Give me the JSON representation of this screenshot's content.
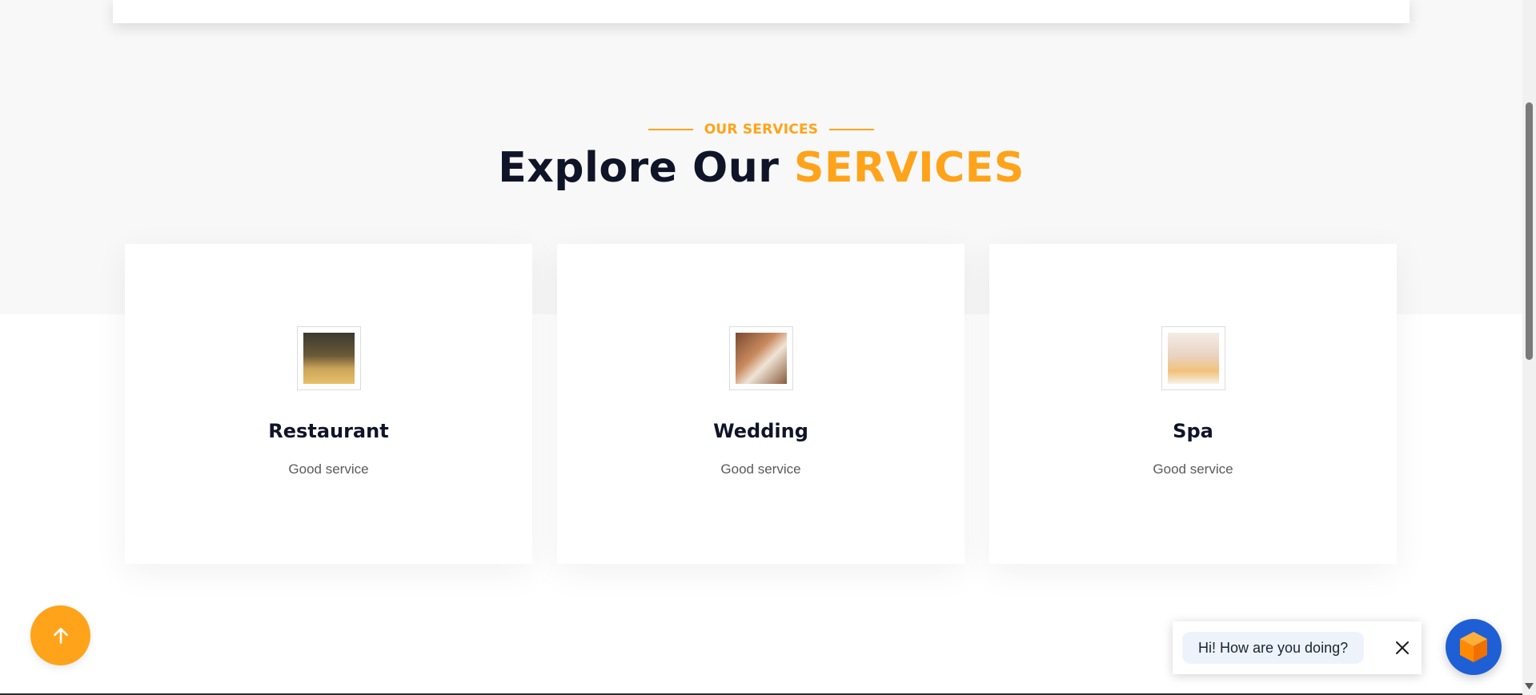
{
  "section": {
    "eyebrow": "OUR SERVICES",
    "heading_main": "Explore Our ",
    "heading_accent": "SERVICES"
  },
  "services": [
    {
      "title": "Restaurant",
      "description": "Good service",
      "image": "restaurant-photo"
    },
    {
      "title": "Wedding",
      "description": "Good service",
      "image": "wedding-photo"
    },
    {
      "title": "Spa",
      "description": "Good service",
      "image": "spa-photo"
    }
  ],
  "chat": {
    "message": "Hi! How are you doing?"
  },
  "colors": {
    "accent": "#ffa31a",
    "heading": "#0f1428",
    "chat_launcher": "#1f5fd6"
  },
  "icons": {
    "scroll_top": "arrow-up-icon",
    "chat_close": "close-icon",
    "chat_launcher": "cube-icon"
  }
}
